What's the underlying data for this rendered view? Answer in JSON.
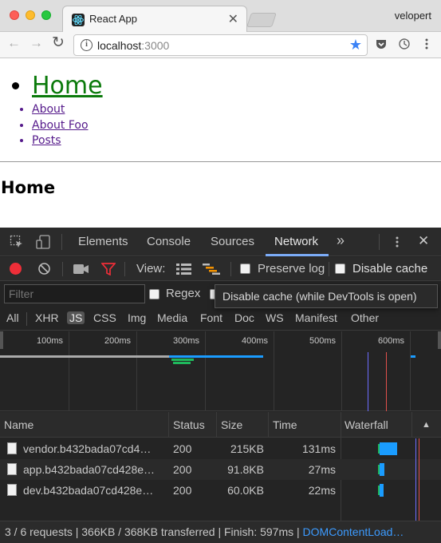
{
  "browser": {
    "tab_title": "React App",
    "tab_close": "✕",
    "profile": "velopert",
    "url_host": "localhost",
    "url_port": ":3000",
    "nav_back": "←",
    "nav_forward": "→",
    "nav_reload": "↻",
    "star": "★"
  },
  "page": {
    "nav": [
      {
        "label": "Home",
        "current": true
      },
      {
        "label": "About"
      },
      {
        "label": "About Foo"
      },
      {
        "label": "Posts"
      }
    ],
    "heading": "Home"
  },
  "devtools": {
    "tabs": [
      "Elements",
      "Console",
      "Sources",
      "Network"
    ],
    "active_tab": "Network",
    "more": "»",
    "close": "✕",
    "view_label": "View:",
    "preserve_log": "Preserve log",
    "disable_cache": "Disable cache",
    "filter_placeholder": "Filter",
    "regex": "Regex",
    "tooltip": "Disable cache (while DevTools is open)",
    "types": [
      "All",
      "XHR",
      "JS",
      "CSS",
      "Img",
      "Media",
      "Font",
      "Doc",
      "WS",
      "Manifest",
      "Other"
    ],
    "selected_type": "JS",
    "timeline_ticks": [
      "100ms",
      "200ms",
      "300ms",
      "400ms",
      "500ms",
      "600ms"
    ],
    "columns": [
      "Name",
      "Status",
      "Size",
      "Time",
      "Waterfall"
    ],
    "sort_arrow": "▲",
    "rows": [
      {
        "name": "vendor.b432bada07cd4…",
        "status": "200",
        "size": "215KB",
        "time": "131ms"
      },
      {
        "name": "app.b432bada07cd428e…",
        "status": "200",
        "size": "91.8KB",
        "time": "27ms"
      },
      {
        "name": "dev.b432bada07cd428e…",
        "status": "200",
        "size": "60.0KB",
        "time": "22ms"
      }
    ],
    "summary": "3 / 6 requests | 366KB / 368KB transferred | Finish: 597ms | ",
    "summary_dcl": "DOMContentLoad…",
    "colors": {
      "accent": "#7cacf8",
      "record": "#ee2e38",
      "bar": "#1a9cff",
      "link": "#3c9bff"
    }
  }
}
